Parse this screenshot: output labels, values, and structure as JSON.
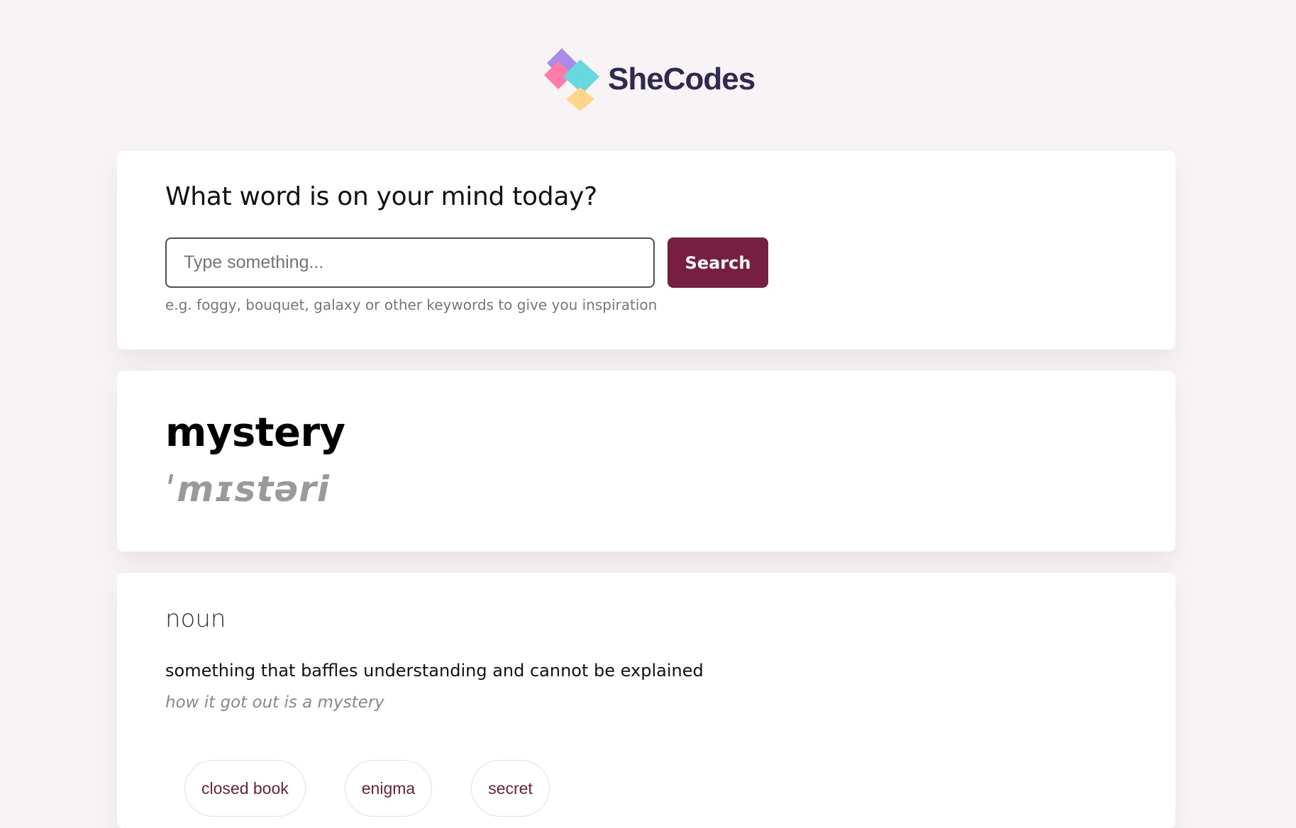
{
  "header": {
    "logo_text": "SheCodes",
    "logo_colors": {
      "purple": "#a88ce7",
      "pink": "#ff7ca8",
      "teal": "#66d8df",
      "yellow": "#ffd58a"
    }
  },
  "search": {
    "question": "What word is on your mind today?",
    "placeholder": "Type something...",
    "button_label": "Search",
    "hint": "e.g. foggy, bouquet, galaxy or other keywords to give you inspiration"
  },
  "result": {
    "word": "mystery",
    "phonetic": "ˈmɪstəri"
  },
  "meaning": {
    "part_of_speech": "noun",
    "definition": "something that baffles understanding and cannot be explained",
    "example": "how it got out is a mystery",
    "synonyms": [
      "closed book",
      "enigma",
      "secret"
    ]
  },
  "colors": {
    "background": "#f8f4f6",
    "accent": "#761f3f",
    "card": "#ffffff"
  }
}
